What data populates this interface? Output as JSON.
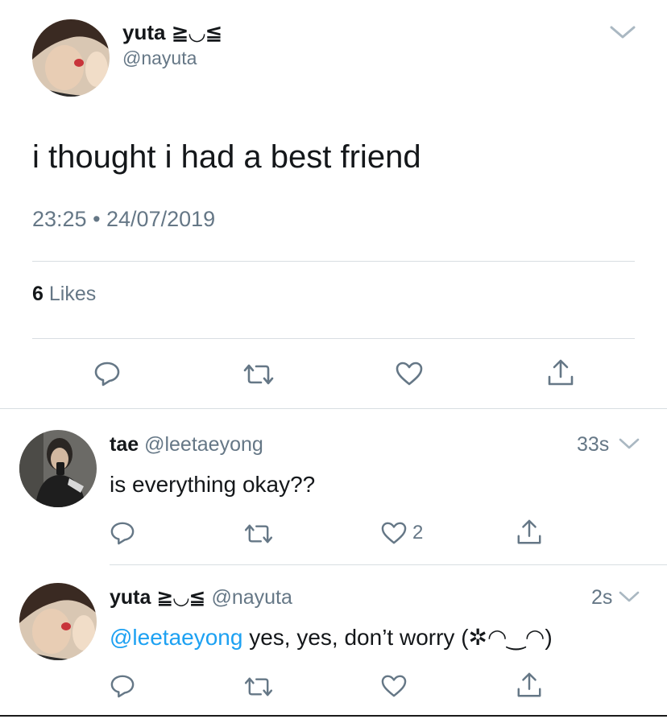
{
  "main_tweet": {
    "display_name": "yuta ≧◡≦",
    "handle": "@nayuta",
    "text": "i thought i had a best friend",
    "timestamp": "23:25 • 24/07/2019",
    "likes_count": "6",
    "likes_label": "Likes"
  },
  "replies": [
    {
      "display_name": "tae",
      "handle": "@leetaeyong",
      "time": "33s",
      "text": "is everything okay??",
      "like_count": "2"
    },
    {
      "display_name": "yuta ≧◡≦",
      "handle": "@nayuta",
      "time": "2s",
      "mention": "@leetaeyong",
      "text": " yes, yes, don’t worry (✲◠‿◠)"
    }
  ],
  "colors": {
    "text": "#14171a",
    "muted": "#657786",
    "link": "#1da1f2",
    "divider": "#d8dee2"
  },
  "icons": [
    "chevron-down-icon",
    "reply-icon",
    "retweet-icon",
    "like-icon",
    "share-icon"
  ]
}
